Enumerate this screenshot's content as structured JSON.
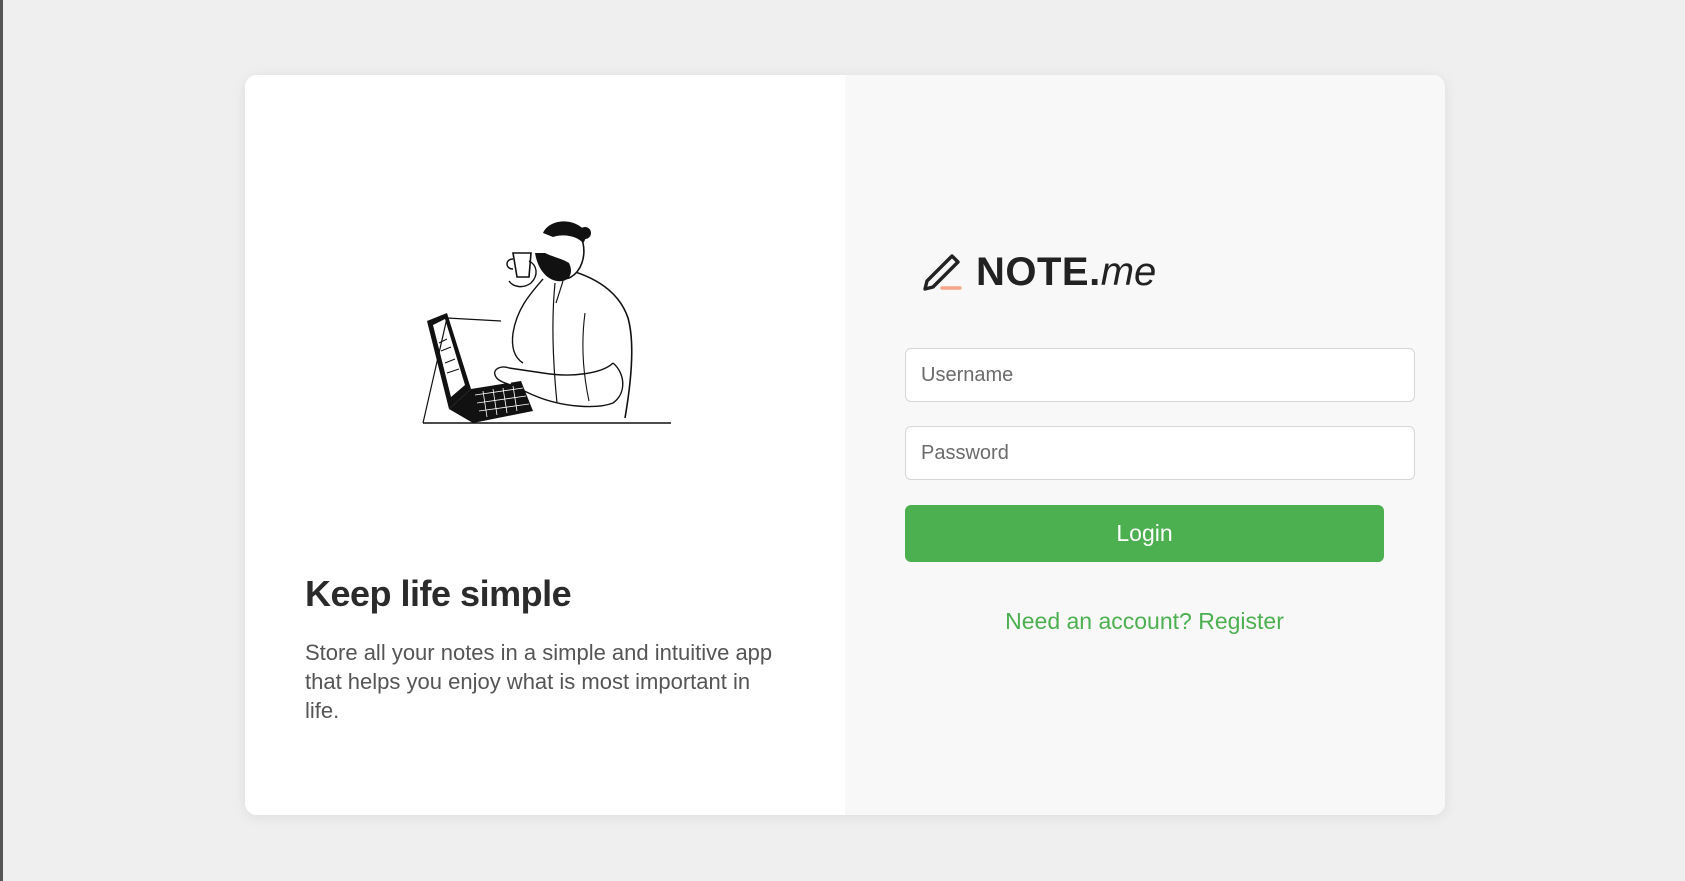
{
  "hero": {
    "title": "Keep life simple",
    "text": "Store all your notes in a simple and intuitive app that helps you enjoy what is most important in life."
  },
  "brand": {
    "name_bold": "NOTE.",
    "name_light": "me",
    "icon": "pencil-icon",
    "accent_color": "#f4a58a"
  },
  "form": {
    "username_placeholder": "Username",
    "password_placeholder": "Password",
    "login_label": "Login",
    "register_text": "Need an account? Register"
  },
  "colors": {
    "primary": "#4caf50",
    "background": "#efefef",
    "right_panel": "#f8f8f8"
  }
}
